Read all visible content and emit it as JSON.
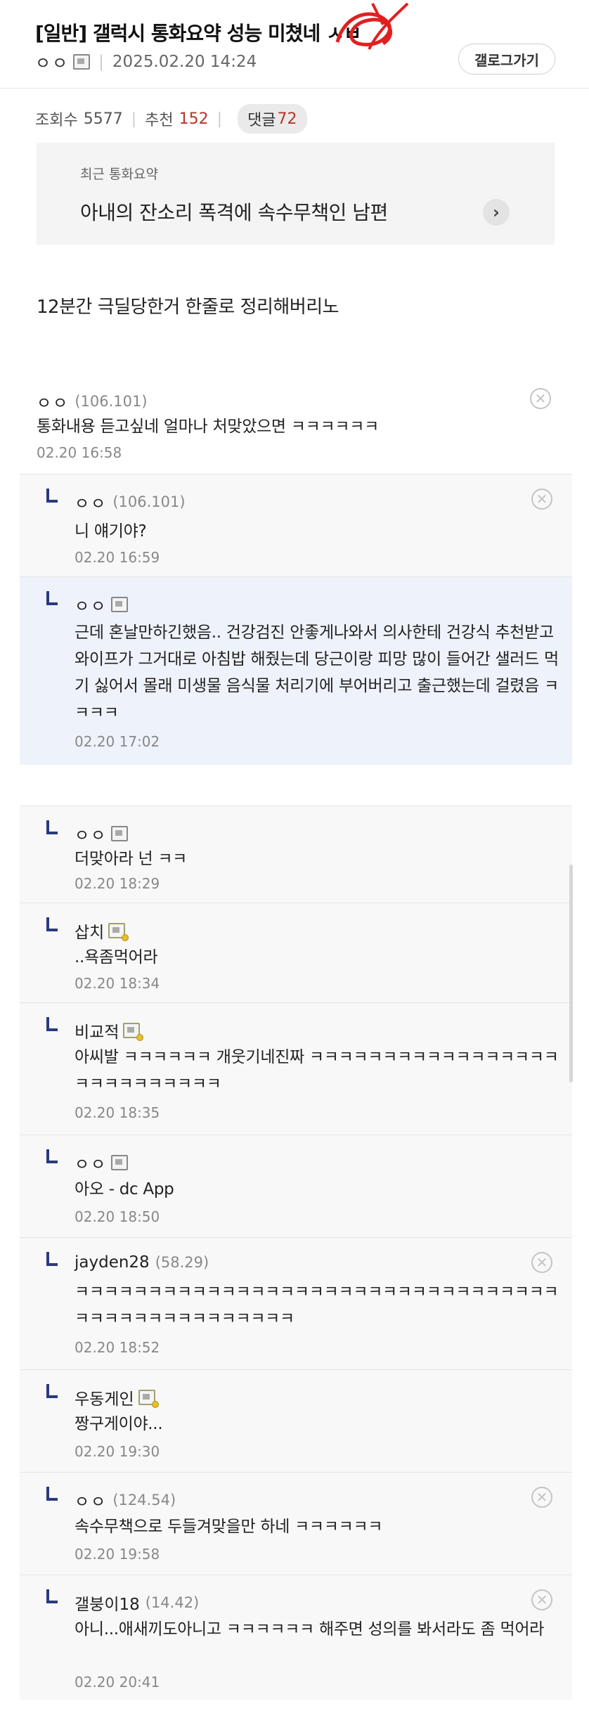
{
  "post": {
    "title": "[일반] 갤럭시 통화요약 성능 미쳤네 ㅅㅂ",
    "author": "ㅇㅇ",
    "date": "2025.02.20 14:24",
    "gallery_button": "갤로그가기"
  },
  "stats": {
    "views_label": "조회수",
    "views": "5577",
    "recommend_label": "추천",
    "recommend": "152",
    "comments_label": "댓글",
    "comments": "72"
  },
  "summary": {
    "label": "최근 통화요약",
    "text": "아내의 잔소리 폭격에 속수무책인 남편"
  },
  "body": {
    "text": "12분간 극딜당한거 한줄로 정리해버리노"
  },
  "comments": [
    {
      "nick": "ㅇㅇ",
      "ip": "(106.101)",
      "text": "통화내용 듣고싶네 얼마나 처맞았으면 ㅋㅋㅋㅋㅋㅋ",
      "date": "02.20 16:58"
    },
    {
      "nick": "ㅇㅇ",
      "ip": "(106.101)",
      "text": "니 얘기야?",
      "date": "02.20 16:59"
    },
    {
      "nick": "ㅇㅇ",
      "text": "근데 혼날만하긴했음.. 건강검진 안좋게나와서 의사한테 건강식 추천받고 와이프가 그거대로 아침밥 해줬는데 당근이랑 피망 많이 들어간 샐러드 먹기 싫어서 몰래 미생물 음식물 처리기에 부어버리고 출근했는데 걸렸음 ㅋㅋㅋㅋ",
      "date": "02.20 17:02"
    },
    {
      "nick": "ㅇㅇ",
      "text": "더맞아라 넌 ㅋㅋ",
      "date": "02.20 18:29"
    },
    {
      "nick": "삽치",
      "text": "..욕좀먹어라",
      "date": "02.20 18:34"
    },
    {
      "nick": "비교적",
      "text": "아씨발 ㅋㅋㅋㅋㅋㅋ 개웃기네진짜 ㅋㅋㅋㅋㅋㅋㅋㅋㅋㅋㅋㅋㅋㅋㅋㅋㅋㅋㅋㅋㅋㅋㅋㅋㅋㅋㅋ",
      "date": "02.20 18:35"
    },
    {
      "nick": "ㅇㅇ",
      "text": "아오 - dc App",
      "date": "02.20 18:50"
    },
    {
      "nick": "jayden28",
      "ip": "(58.29)",
      "text": "ㅋㅋㅋㅋㅋㅋㅋㅋㅋㅋㅋㅋㅋㅋㅋㅋㅋㅋㅋㅋㅋㅋㅋㅋㅋㅋㅋㅋㅋㅋㅋㅋㅋㅋㅋㅋㅋㅋㅋㅋㅋㅋㅋㅋㅋㅋㅋㅋ",
      "date": "02.20 18:52"
    },
    {
      "nick": "우동게인",
      "text": "짱구게이야...",
      "date": "02.20 19:30"
    },
    {
      "nick": "ㅇㅇ",
      "ip": "(124.54)",
      "text": "속수무책으로 두들겨맞을만 하네 ㅋㅋㅋㅋㅋㅋ",
      "date": "02.20 19:58"
    },
    {
      "nick": "갤붕이18",
      "ip": "(14.42)",
      "text": "아니...애새끼도아니고 ㅋㅋㅋㅋㅋㅋ 해주면 성의를 봐서라도 좀 먹어라",
      "date": "02.20 20:41"
    }
  ]
}
